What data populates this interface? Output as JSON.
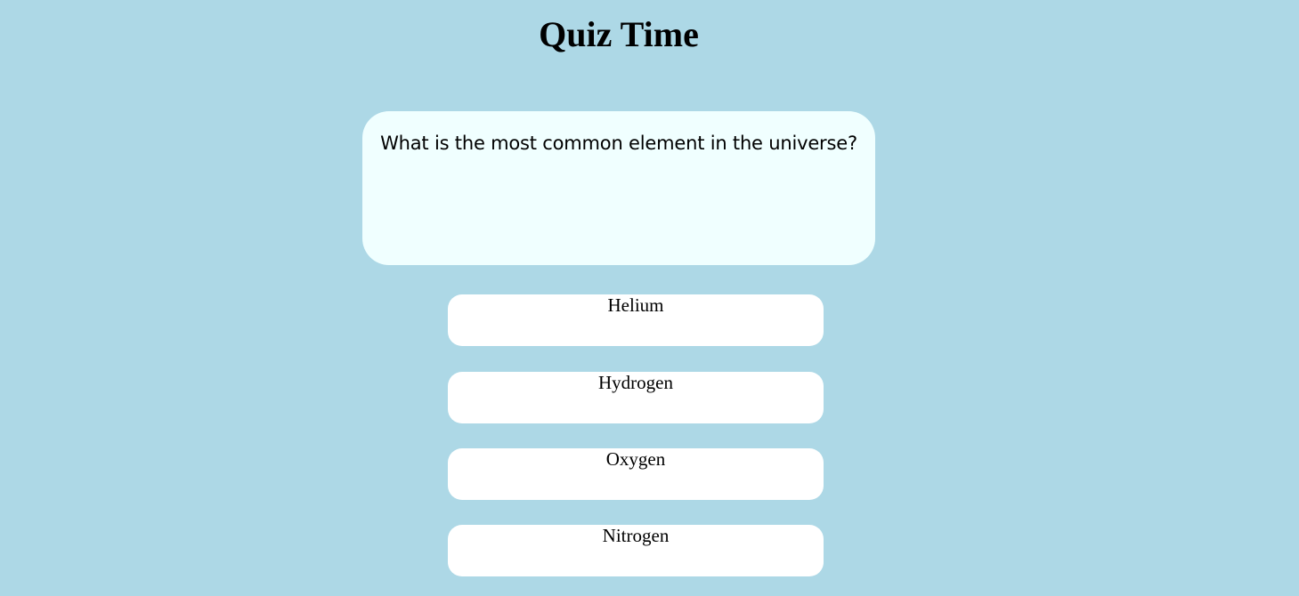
{
  "page": {
    "title": "Quiz Time"
  },
  "question": {
    "text": "What is the most common element in the universe?"
  },
  "answers": [
    {
      "label": "Helium"
    },
    {
      "label": "Hydrogen"
    },
    {
      "label": "Oxygen"
    },
    {
      "label": "Nitrogen"
    }
  ],
  "colors": {
    "background": "#add8e6",
    "question_card": "#f0ffff",
    "answer_button": "#ffffff",
    "text": "#000000"
  }
}
